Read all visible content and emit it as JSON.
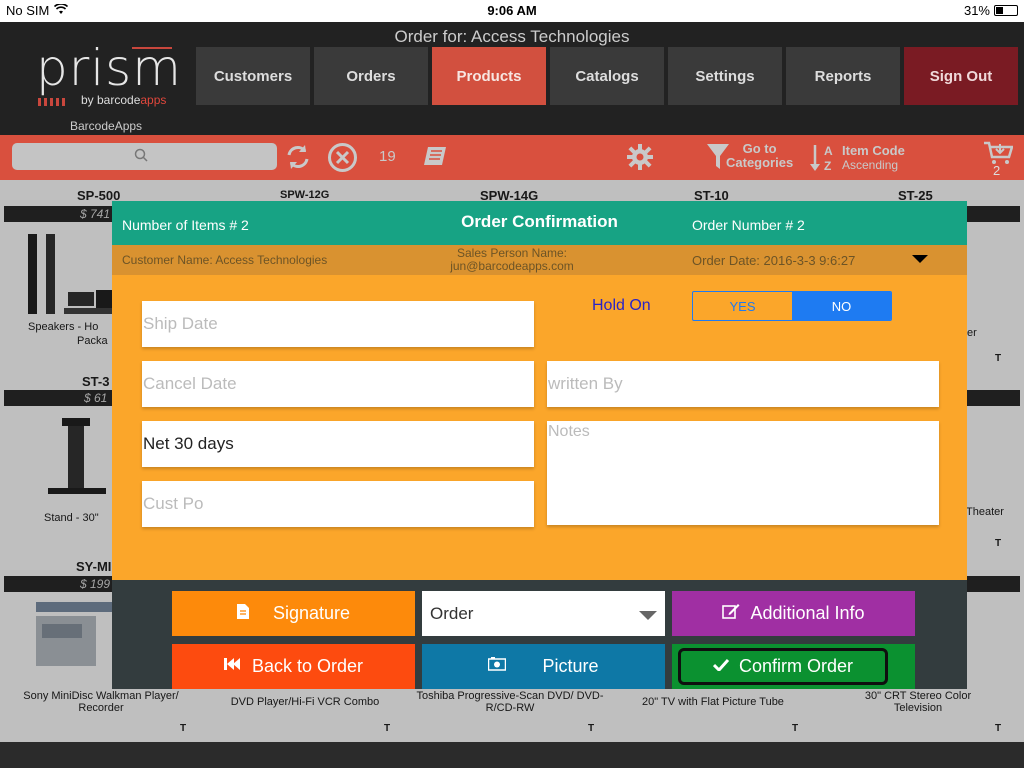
{
  "status_bar": {
    "carrier": "No SIM",
    "time": "9:06 AM",
    "battery": "31%"
  },
  "header": {
    "order_for": "Order for: Access Technologies",
    "logo_word": "prism",
    "logo_by": "by barcode",
    "logo_apps": "apps",
    "brand_sub": "BarcodeApps",
    "nav": [
      "Customers",
      "Orders",
      "Products",
      "Catalogs",
      "Settings",
      "Reports",
      "Sign Out"
    ]
  },
  "toolbar": {
    "count": "19",
    "goto_line1": "Go to",
    "goto_line2": "Categories",
    "sort_line1": "Item Code",
    "sort_line2": "Ascending",
    "cart_count": "2"
  },
  "grid": {
    "skus_row1": [
      "SP-500",
      "SPW-12G",
      "SPW-14G",
      "ST-10",
      "ST-25"
    ],
    "price_row1": "$ 741",
    "row1_name_left": "Speakers - Ho",
    "row1_name_left2": "Packa",
    "row1_name_right": "er",
    "sku_row2": "ST-3",
    "price_row2": "$ 61",
    "row2_name_left": "Stand - 30\"",
    "row2_name_right": "Theater",
    "sku_row3": "SY-MI",
    "price_row3": "$ 199",
    "row3_names": [
      "Sony MiniDisc Walkman Player/ Recorder",
      "DVD Player/Hi-Fi VCR Combo",
      "Toshiba Progressive-Scan DVD/ DVD-R/CD-RW",
      "20\" TV with Flat Picture Tube",
      "30\" CRT Stereo Color Television"
    ],
    "t_char": "T"
  },
  "modal": {
    "items_label": "Number of Items # 2",
    "title": "Order Confirmation",
    "order_number": "Order Number # 2",
    "customer": "Customer Name: Access Technologies",
    "sales_person_label": "Sales Person Name:",
    "sales_person_email": "jun@barcodeapps.com",
    "order_date": "Order Date: 2016-3-3 9:6:27",
    "ship_date_placeholder": "Ship Date",
    "cancel_date_placeholder": "Cancel Date",
    "terms_value": "Net 30 days",
    "cust_po_placeholder": "Cust Po",
    "hold_on_label": "Hold On",
    "hold_yes": "YES",
    "hold_no": "NO",
    "written_by_placeholder": "written By",
    "notes_placeholder": "Notes",
    "buttons": {
      "signature": "Signature",
      "order_select": "Order",
      "additional_info": "Additional Info",
      "back_to_order": "Back to Order",
      "picture": "Picture",
      "confirm_order": "Confirm Order"
    }
  },
  "colors": {
    "header_bg": "#222222",
    "toolbar_red": "#d9503e",
    "modal_orange": "#fba62a",
    "modal_teal": "#17a384",
    "segment_blue": "#1e7bf2"
  }
}
